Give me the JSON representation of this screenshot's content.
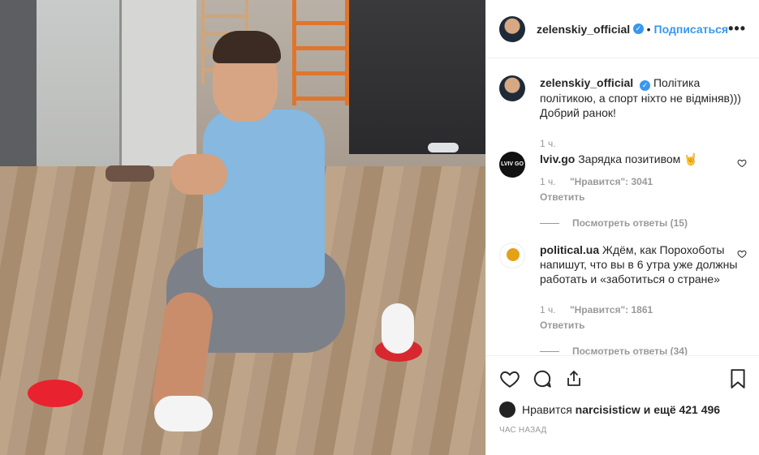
{
  "post": {
    "username": "zelenskiy_official",
    "verified": true,
    "separator": "•",
    "follow_label": "Подписаться",
    "more_label": "•••",
    "image_alt": "workout photo"
  },
  "caption": {
    "username": "zelenskiy_official",
    "text": "Політика політикою, а спорт ніхто не відміняв))) Добрий ранок!",
    "time": "1 ч."
  },
  "comments": [
    {
      "username": "lviv.go",
      "avatar_text": "LVIV GO",
      "text": "Зарядка позитивом 🤘",
      "time": "1 ч.",
      "likes": "\"Нравится\": 3041",
      "reply_label": "Ответить",
      "view_replies": "Посмотреть ответы (15)"
    },
    {
      "username": "political.ua",
      "text": "Ждём, как Порохоботы напишут, что вы в 6 утра уже должны работать и «заботиться о стране»",
      "time": "1 ч.",
      "likes": "\"Нравится\": 1861",
      "reply_label": "Ответить",
      "view_replies": "Посмотреть ответы (34)"
    }
  ],
  "footer": {
    "likes_prefix": "Нравится",
    "likes_user": "narcisisticw",
    "likes_suffix": "и ещё 421 496",
    "timestamp": "ЧАС НАЗАД"
  },
  "icons": {
    "like": "heart-icon",
    "comment": "comment-icon",
    "share": "share-icon",
    "save": "bookmark-icon"
  },
  "colors": {
    "link": "#3897f0",
    "muted": "#999999",
    "text": "#262626"
  }
}
